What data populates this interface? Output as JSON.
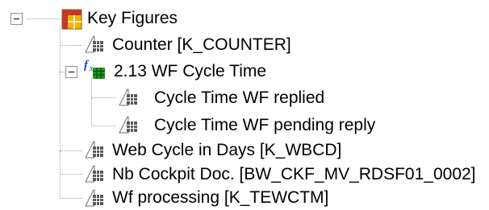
{
  "tree": {
    "root": {
      "label": "Key Figures",
      "icon": "key-figures-folder-icon",
      "expanded": true
    },
    "items": [
      {
        "label": "Counter [K_COUNTER]",
        "icon": "key-figure-icon"
      },
      {
        "label": "2.13 WF Cycle Time",
        "icon": "formula-icon",
        "expanded": true,
        "children": [
          {
            "label": "Cycle Time WF replied",
            "icon": "key-figure-icon"
          },
          {
            "label": "Cycle Time WF pending reply",
            "icon": "key-figure-icon"
          }
        ]
      },
      {
        "label": "Web Cycle in Days [K_WBCD]",
        "icon": "key-figure-icon"
      },
      {
        "label": "Nb Cockpit Doc. [BW_CKF_MV_RDSF01_0002]",
        "icon": "key-figure-icon"
      },
      {
        "label": "Wf processing [K_TEWCTM]",
        "icon": "key-figure-icon"
      }
    ],
    "colors": {
      "tree_lines": "#a0a0a0",
      "folder_header": "#c0392b",
      "folder_grid": "#f0b400",
      "formula_f": "#1f3fd6",
      "formula_grid": "#1a9a1a"
    }
  }
}
